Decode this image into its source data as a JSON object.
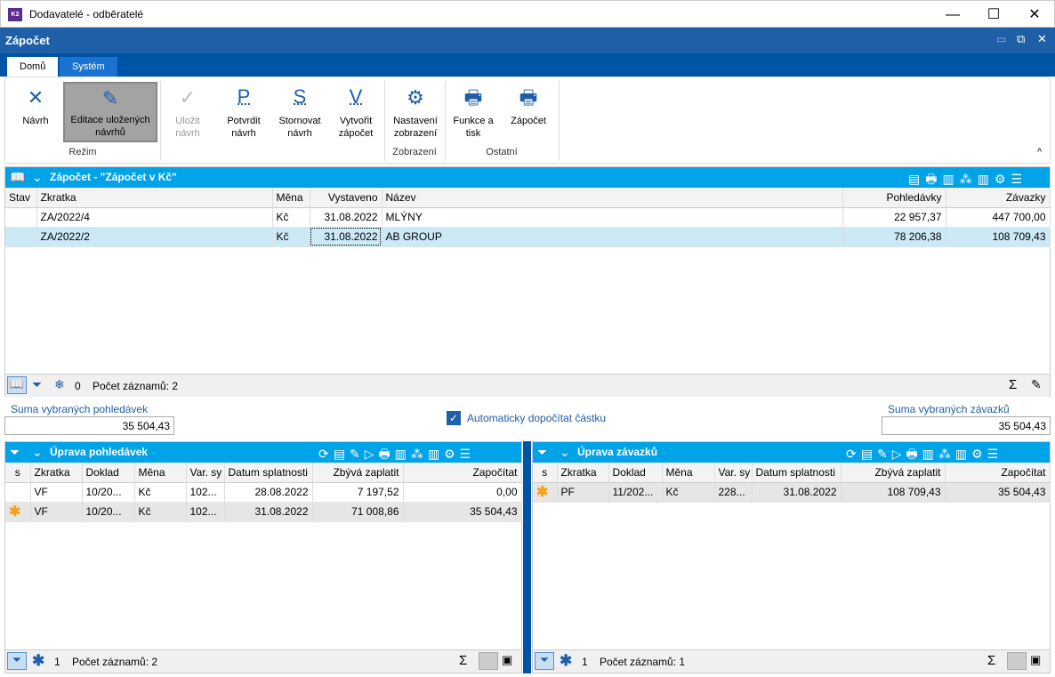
{
  "window": {
    "title": "Dodavatelé - odběratelé",
    "app_icon": "K2",
    "minimize": "—",
    "maximize": "☐",
    "close": "✕"
  },
  "app_header": {
    "title": "Zápočet"
  },
  "tabs": [
    {
      "label": "Domů",
      "active": true
    },
    {
      "label": "Systém",
      "active": false
    }
  ],
  "ribbon": {
    "buttons": [
      {
        "label": "Návrh",
        "icon": "tools-icon"
      },
      {
        "label": "Editace uložených návrhů",
        "icon": "pencil-icon",
        "active": true
      },
      {
        "label": "Uložit návrh",
        "icon": "check-icon",
        "disabled": true
      },
      {
        "label": "Potvrdit návrh",
        "glyph": "P"
      },
      {
        "label": "Stornovat návrh",
        "glyph": "S"
      },
      {
        "label": "Vytvořit zápočet",
        "glyph": "V"
      },
      {
        "label": "Nastavení zobrazení",
        "icon": "gear-icon"
      },
      {
        "label": "Funkce a tisk",
        "icon": "printer-icon"
      },
      {
        "label": "Zápočet",
        "icon": "printer-icon"
      }
    ],
    "groups": [
      "Režim",
      "Zobrazení",
      "Ostatní"
    ]
  },
  "top_panel": {
    "title": "Zápočet - \"Zápočet v Kč\"",
    "columns": [
      "Stav",
      "Zkratka",
      "Měna",
      "Vystaveno",
      "Název",
      "Pohledávky",
      "Závazky"
    ],
    "rows": [
      [
        "",
        "ZA/2022/4",
        "Kč",
        "31.08.2022",
        "MLÝNY",
        "22 957,37",
        "447 700,00"
      ],
      [
        "",
        "ZA/2022/2",
        "Kč",
        "31.08.2022",
        "AB GROUP",
        "78 206,38",
        "108 709,43"
      ]
    ],
    "footer": {
      "count": "0",
      "records": "Počet záznamů: 2"
    }
  },
  "sums": {
    "receivables_label": "Suma vybraných pohledávek",
    "receivables_value": "35 504,43",
    "auto_label": "Automaticky dopočítat částku",
    "auto_checked": true,
    "payables_label": "Suma vybraných závazků",
    "payables_value": "35 504,43"
  },
  "left_panel": {
    "title": "Úprava pohledávek",
    "columns": [
      "s",
      "Zkratka",
      "Doklad",
      "Měna",
      "Var. sy",
      "Datum splatnosti",
      "Zbývá zaplatit",
      "Započítat"
    ],
    "rows": [
      [
        "",
        "VF",
        "10/20...",
        "Kč",
        "102...",
        "28.08.2022",
        "7 197,52",
        "0,00"
      ],
      [
        "✱",
        "VF",
        "10/20...",
        "Kč",
        "102...",
        "31.08.2022",
        "71 008,86",
        "35 504,43"
      ]
    ],
    "footer": {
      "count": "1",
      "records": "Počet záznamů: 2"
    }
  },
  "right_panel": {
    "title": "Úprava závazků",
    "columns": [
      "s",
      "Zkratka",
      "Doklad",
      "Měna",
      "Var. sy",
      "Datum splatnosti",
      "Zbývá zaplatit",
      "Započítat"
    ],
    "rows": [
      [
        "✱",
        "PF",
        "11/202...",
        "Kč",
        "228...",
        "31.08.2022",
        "108 709,43",
        "35 504,43"
      ]
    ],
    "footer": {
      "count": "1",
      "records": "Počet záznamů: 1"
    }
  },
  "colors": {
    "app_blue": "#1f5fa8",
    "panel_cyan": "#00a2e8",
    "selected_row": "#cbeaf6",
    "star": "#f7a21b"
  }
}
